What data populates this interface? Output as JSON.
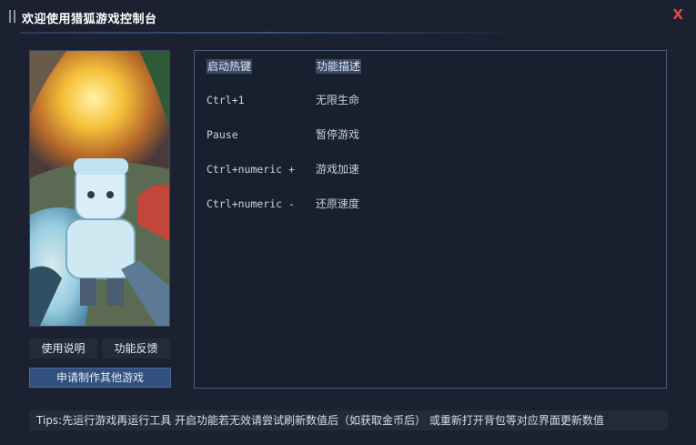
{
  "window": {
    "title": "欢迎使用猎狐游戏控制台",
    "close_label": "X",
    "accent_color": "#e24a4a"
  },
  "sidebar": {
    "help_label": "使用说明",
    "feedback_label": "功能反馈",
    "request_label": "申请制作其他游戏"
  },
  "hotkeys": {
    "header_key": "启动热键",
    "header_desc": "功能描述",
    "rows": [
      {
        "key": "Ctrl+1",
        "desc": "无限生命"
      },
      {
        "key": "Pause",
        "desc": "暂停游戏"
      },
      {
        "key": "Ctrl+numeric +",
        "desc": "游戏加速"
      },
      {
        "key": "Ctrl+numeric -",
        "desc": "还原速度"
      }
    ]
  },
  "tips": "Tips:先运行游戏再运行工具  开启功能若无效请尝试刷新数值后（如获取金币后） 或重新打开背包等对应界面更新数值"
}
